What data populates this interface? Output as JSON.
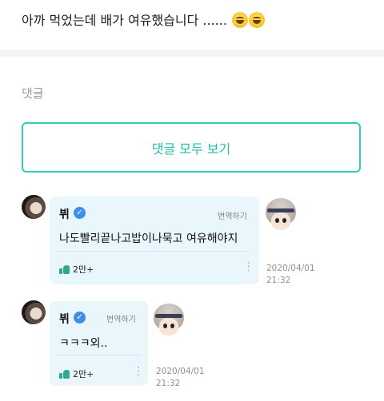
{
  "post": {
    "text": "아까 먹었는데 배가 여유했습니다 ......",
    "emoji": [
      "grinning-sweat-emoji",
      "grinning-sweat-emoji"
    ]
  },
  "comments_section": {
    "title": "댓글",
    "view_all_label": "댓글 모두 보기"
  },
  "comments": [
    {
      "author": "뷔",
      "verified": true,
      "translate_label": "번역하기",
      "text": "나도빨리끝나고밥이나묵고 여유해야지",
      "likes": "2만+",
      "date": "2020/04/01",
      "time": "21:32"
    },
    {
      "author": "뷔",
      "verified": true,
      "translate_label": "번역하기",
      "text": "ㅋㅋㅋ외..",
      "likes": "2만+",
      "date": "2020/04/01",
      "time": "21:32"
    }
  ],
  "colors": {
    "accent": "#2ecfb2",
    "bubble": "#e9f6fc",
    "verified": "#3d8ee8"
  }
}
